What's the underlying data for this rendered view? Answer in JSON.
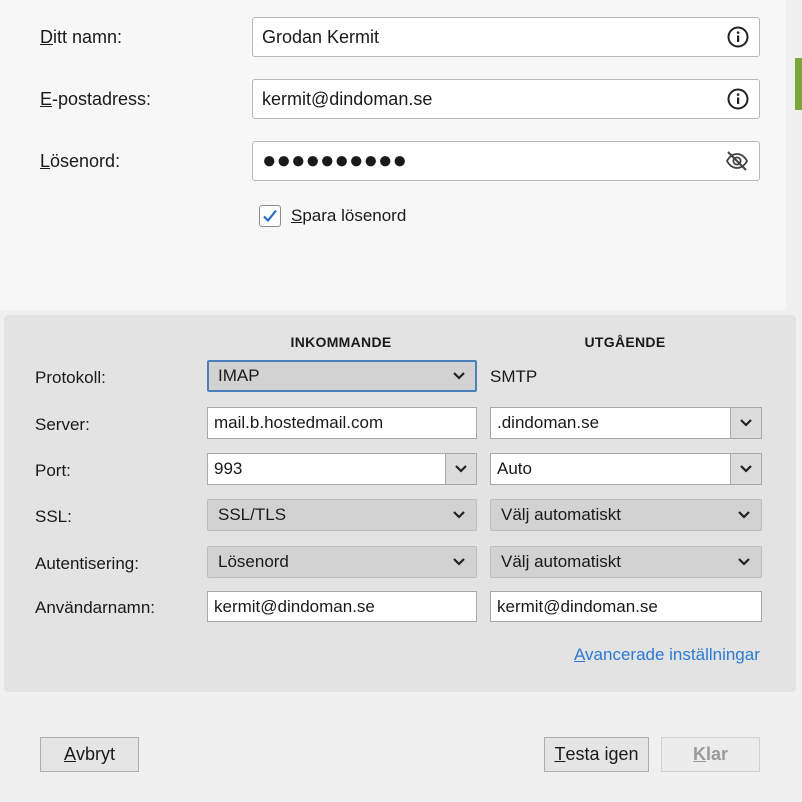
{
  "account": {
    "name_label_first": "D",
    "name_label_rest": "itt namn:",
    "name_value": "Grodan Kermit",
    "email_label_first": "E",
    "email_label_rest": "-postadress:",
    "email_value": "kermit@dindoman.se",
    "password_label_first": "L",
    "password_label_rest": "ösenord:",
    "password_value": "●●●●●●●●●●",
    "remember_first": "S",
    "remember_rest": "para lösenord",
    "remember_checked": true
  },
  "server": {
    "incoming_header": "INKOMMANDE",
    "outgoing_header": "UTGÅENDE",
    "rows": {
      "protocol": {
        "label": "Protokoll:",
        "incoming": "IMAP",
        "outgoing": "SMTP"
      },
      "server": {
        "label": "Server:",
        "incoming": "mail.b.hostedmail.com",
        "outgoing": ".dindoman.se"
      },
      "port": {
        "label": "Port:",
        "incoming": "993",
        "outgoing": "Auto"
      },
      "ssl": {
        "label": "SSL:",
        "incoming": "SSL/TLS",
        "outgoing": "Välj automatiskt"
      },
      "auth": {
        "label": "Autentisering:",
        "incoming": "Lösenord",
        "outgoing": "Välj automatiskt"
      },
      "username": {
        "label": "Användarnamn:",
        "incoming": "kermit@dindoman.se",
        "outgoing": "kermit@dindoman.se"
      }
    },
    "advanced_first": "A",
    "advanced_rest": "vancerade inställningar"
  },
  "buttons": {
    "cancel_first": "A",
    "cancel_rest": "vbryt",
    "retest_first": "T",
    "retest_rest": "esta igen",
    "done_first": "K",
    "done_rest": "lar"
  },
  "colors": {
    "link": "#2a7bd1",
    "accent": "#4a7fc0",
    "check": "#1f6fc9"
  },
  "icons": [
    "info-icon",
    "eye-slash-icon",
    "checkmark-icon",
    "chevron-down-icon"
  ]
}
